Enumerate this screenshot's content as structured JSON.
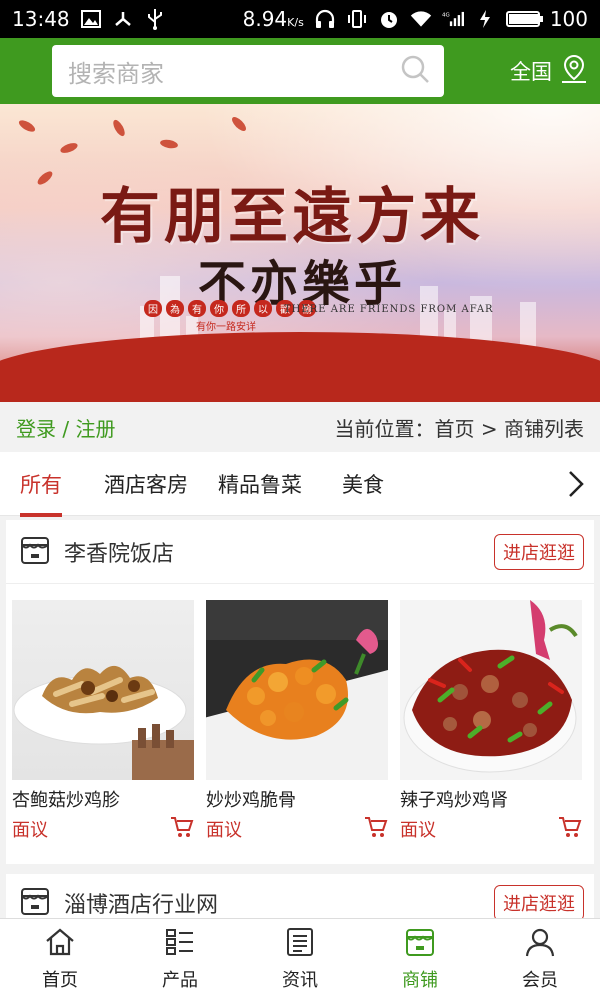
{
  "status_bar": {
    "time": "13:48",
    "net_speed": "8.94",
    "net_speed_unit": "K/s",
    "battery": "100",
    "battery_level": 1.0
  },
  "header": {
    "search_placeholder": "搜索商家",
    "region_label": "全国",
    "search_icon": "search-icon",
    "location_icon": "location-pin-icon",
    "accent_color": "#3f9a1f"
  },
  "banner": {
    "title": "有朋至遠方来",
    "subtitle": "不亦樂乎",
    "english": "THERE ARE FRIENDS FROM AFAR",
    "seal_chars": [
      "因",
      "為",
      "有",
      "你",
      "所",
      "以",
      "歡",
      "愉"
    ],
    "seal_line": "有你一路安详"
  },
  "location_bar": {
    "login": "登录",
    "separator": " / ",
    "register": "注册",
    "breadcrumb_prefix": "当前位置：",
    "breadcrumb_home": "首页",
    "breadcrumb_arrow": " > ",
    "breadcrumb_current": "商铺列表"
  },
  "tabs": [
    {
      "label": "所有",
      "active": true
    },
    {
      "label": "酒店客房",
      "active": false
    },
    {
      "label": "精品鲁菜",
      "active": false
    },
    {
      "label": "美食",
      "active": false
    }
  ],
  "shops": [
    {
      "name": "李香院饭店",
      "visit_label": "进店逛逛",
      "products": [
        {
          "name": "杏鲍菇炒鸡胗",
          "price": "面议"
        },
        {
          "name": "妙炒鸡脆骨",
          "price": "面议"
        },
        {
          "name": "辣子鸡炒鸡肾",
          "price": "面议"
        }
      ]
    },
    {
      "name": "淄博酒店行业网",
      "visit_label": "进店逛逛",
      "products": []
    }
  ],
  "bottom_nav": [
    {
      "label": "首页",
      "icon": "home-icon",
      "active": false
    },
    {
      "label": "产品",
      "icon": "grid-list-icon",
      "active": false
    },
    {
      "label": "资讯",
      "icon": "news-icon",
      "active": false
    },
    {
      "label": "商铺",
      "icon": "shop-icon",
      "active": true
    },
    {
      "label": "会员",
      "icon": "user-icon",
      "active": false
    }
  ],
  "colors": {
    "brand_green": "#3f9a1f",
    "accent_red": "#c8322b"
  }
}
